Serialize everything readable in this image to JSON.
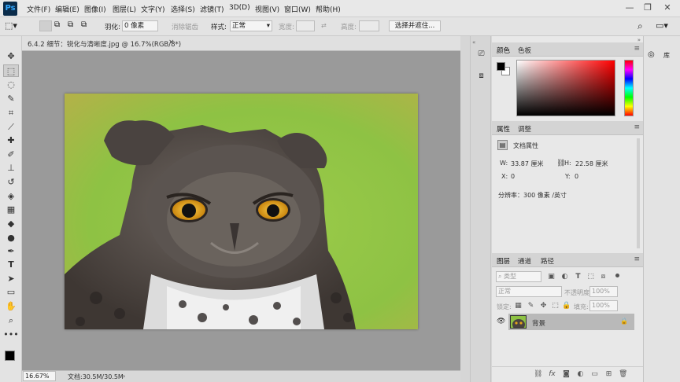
{
  "app": {
    "logo": "Ps"
  },
  "menu": [
    "文件(F)",
    "编辑(E)",
    "图像(I)",
    "图层(L)",
    "文字(Y)",
    "选择(S)",
    "滤镜(T)",
    "3D(D)",
    "视图(V)",
    "窗口(W)",
    "帮助(H)"
  ],
  "window_controls": {
    "minimize": "—",
    "restore": "❐",
    "close": "✕"
  },
  "options": {
    "feather_label": "羽化:",
    "feather_value": "0 像素",
    "antialias_label": "消除锯齿",
    "style_label": "样式:",
    "style_value": "正常",
    "width_label": "宽度:",
    "height_label": "高度:",
    "select_mask_button": "选择并遮住..."
  },
  "document": {
    "title": "6.4.2 细节：锐化与清晰度.jpg @ 16.7%(RGB/8*)",
    "close": "×",
    "zoom": "16.67%",
    "doc_size": "文档:30.5M/30.5M"
  },
  "tools": [
    "move-tool-icon",
    "marquee-tool-icon",
    "lasso-tool-icon",
    "quick-select-tool-icon",
    "crop-tool-icon",
    "eyedropper-tool-icon",
    "healing-brush-tool-icon",
    "brush-tool-icon",
    "clone-stamp-tool-icon",
    "history-brush-tool-icon",
    "eraser-tool-icon",
    "gradient-tool-icon",
    "blur-tool-icon",
    "dodge-tool-icon",
    "pen-tool-icon",
    "type-tool-icon",
    "path-select-tool-icon",
    "rectangle-tool-icon",
    "hand-tool-icon",
    "zoom-tool-icon",
    "more-tools-icon"
  ],
  "color_panel": {
    "tabs": [
      "颜色",
      "色板"
    ],
    "foreground": "#000000",
    "background": "#ffffff"
  },
  "properties_panel": {
    "tabs": [
      "属性",
      "调整"
    ],
    "doc_props_label": "文档属性",
    "w_label": "W:",
    "w_value": "33.87 厘米",
    "h_label": "H:",
    "h_value": "22.58 厘米",
    "x_label": "X:",
    "x_value": "0",
    "y_label": "Y:",
    "y_value": "0",
    "resolution": "分辨率：300 像素 /英寸"
  },
  "layers_panel": {
    "tabs": [
      "图层",
      "通道",
      "路径"
    ],
    "filter_kind": "类型",
    "blend_mode": "正常",
    "opacity_label": "不透明度:",
    "opacity_value": "100%",
    "lock_label": "锁定:",
    "fill_label": "填充:",
    "fill_value": "100%",
    "layers": [
      {
        "name": "背景",
        "visible": true,
        "locked": true
      }
    ]
  },
  "libraries": {
    "label": "库"
  },
  "colors": {
    "accent": "#31a8ff",
    "selected_layer": "#b9b9b9"
  }
}
